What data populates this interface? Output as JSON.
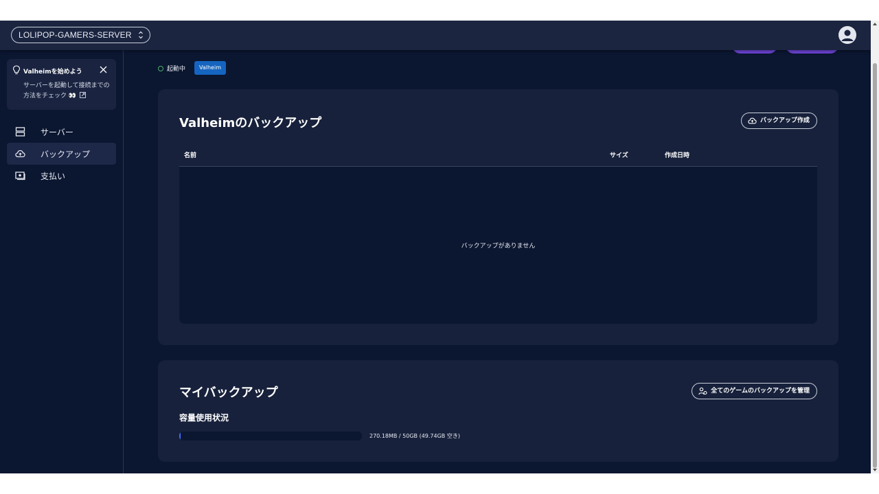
{
  "topbar": {
    "server_name": "LOLIPOP-GAMERS-SERVER",
    "avatar_icon": "user-avatar-icon"
  },
  "sidebar": {
    "tip": {
      "title": "Valheimを始めよう",
      "body": "サーバーを起動して接続までの方法をチェック",
      "emoji": "👀"
    },
    "items": [
      {
        "label": "サーバー",
        "icon": "server-icon",
        "active": false
      },
      {
        "label": "バックアップ",
        "icon": "cloud-upload-icon",
        "active": true
      },
      {
        "label": "支払い",
        "icon": "payment-icon",
        "active": false
      }
    ]
  },
  "status": {
    "text": "起動中",
    "badge": "Valheim"
  },
  "backups_card": {
    "title": "Valheimのバックアップ",
    "create_button": "バックアップ作成",
    "columns": [
      "名前",
      "サイズ",
      "作成日時"
    ],
    "empty_message": "バックアップがありません"
  },
  "my_backups_card": {
    "title": "マイバックアップ",
    "manage_button": "全てのゲームのバックアップを管理",
    "usage_label": "容量使用状況",
    "usage_text": "270.18MB / 50GB (49.74GB 空き)",
    "usage_fraction": 0.0054
  },
  "colors": {
    "background": "#0b1630",
    "card": "#17213b",
    "topbar": "#1b2540",
    "accent": "#6d45d8",
    "badge": "#1565c0",
    "status_ok": "#4caf6a"
  }
}
